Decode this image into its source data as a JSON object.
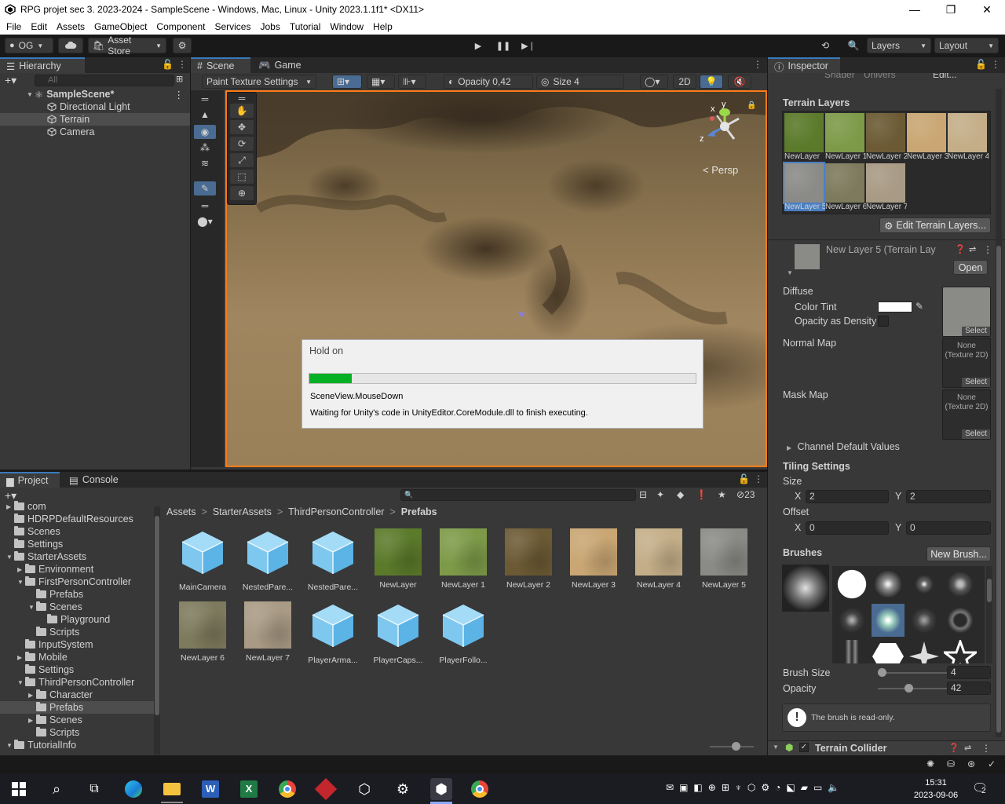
{
  "window": {
    "title": "RPG projet sec 3. 2023-2024 - SampleScene - Windows, Mac, Linux - Unity 2023.1.1f1* <DX11>",
    "controls": [
      "—",
      "❐",
      "✕"
    ]
  },
  "menu": [
    "File",
    "Edit",
    "Assets",
    "GameObject",
    "Component",
    "Services",
    "Jobs",
    "Tutorial",
    "Window",
    "Help"
  ],
  "toolbar": {
    "account": "OG",
    "asset_store": "Asset Store",
    "layers": "Layers",
    "layout": "Layout"
  },
  "hierarchy": {
    "tab": "Hierarchy",
    "search_placeholder": "All",
    "scene": "SampleScene*",
    "items": [
      "Directional Light",
      "Terrain",
      "Camera"
    ]
  },
  "scene": {
    "tabs": [
      "Scene",
      "Game"
    ],
    "tool_dropdown": "Paint Texture Settings",
    "opacity_label": "Opacity 0,42",
    "size_label": "Size 4",
    "mode_2d": "2D",
    "persp": "Persp",
    "gizmo": {
      "y": "y",
      "x": "x",
      "z": "z"
    }
  },
  "dialog": {
    "title": "Hold on",
    "progress": 0.11,
    "line1": "SceneView.MouseDown",
    "line2": "Waiting for Unity's code in UnityEditor.CoreModule.dll to finish executing."
  },
  "inspector": {
    "tab": "Inspector",
    "top_row": {
      "shader": "Shader",
      "univers": "Univers",
      "edit": "Edit..."
    },
    "terrain_layers_title": "Terrain Layers",
    "layers": [
      {
        "caption": "NewLayer",
        "color": "#5b7a2a"
      },
      {
        "caption": "NewLayer 1",
        "color": "#7d9a48"
      },
      {
        "caption": "NewLayer 2",
        "color": "#6b5a34"
      },
      {
        "caption": "NewLayer 3",
        "color": "#c9a673"
      },
      {
        "caption": "NewLayer 4",
        "color": "#c4ae88"
      },
      {
        "caption": "NewLayer 5",
        "color": "#8a8a86"
      },
      {
        "caption": "NewLayer 6",
        "color": "#7d7a5d"
      },
      {
        "caption": "NewLayer 7",
        "color": "#a89a84"
      }
    ],
    "edit_layers_button": "Edit Terrain Layers...",
    "layer_name": "New Layer 5 (Terrain Lay",
    "open_button": "Open",
    "diffuse": "Diffuse",
    "color_tint": "Color Tint",
    "opacity_density": "Opacity as Density",
    "normal_map": "Normal Map",
    "mask_map": "Mask Map",
    "none_texture": "None\n(Texture 2D)",
    "select": "Select",
    "channel_defaults": "Channel Default Values",
    "tiling_title": "Tiling Settings",
    "size_label": "Size",
    "offset_label": "Offset",
    "x_label": "X",
    "y_label": "Y",
    "size_x": "2",
    "size_y": "2",
    "offset_x": "0",
    "offset_y": "0",
    "brushes_title": "Brushes",
    "new_brush": "New Brush...",
    "brush_size_label": "Brush Size",
    "brush_size_value": "4",
    "brush_size_fraction": 0.05,
    "opacity_label": "Opacity",
    "opacity_value": "42",
    "opacity_fraction": 0.42,
    "readonly_msg": "The brush is read-only.",
    "collider": "Terrain Collider"
  },
  "project": {
    "tabs": [
      "Project",
      "Console"
    ],
    "count": "23",
    "breadcrumb": [
      "Assets",
      "StarterAssets",
      "ThirdPersonController",
      "Prefabs"
    ],
    "tree": [
      {
        "label": "com",
        "indent": 1,
        "arrow": "▶"
      },
      {
        "label": "HDRPDefaultResources",
        "indent": 1,
        "arrow": ""
      },
      {
        "label": "Scenes",
        "indent": 1,
        "arrow": ""
      },
      {
        "label": "Settings",
        "indent": 1,
        "arrow": ""
      },
      {
        "label": "StarterAssets",
        "indent": 1,
        "arrow": "▼"
      },
      {
        "label": "Environment",
        "indent": 2,
        "arrow": "▶"
      },
      {
        "label": "FirstPersonController",
        "indent": 2,
        "arrow": "▼"
      },
      {
        "label": "Prefabs",
        "indent": 3,
        "arrow": ""
      },
      {
        "label": "Scenes",
        "indent": 3,
        "arrow": "▼"
      },
      {
        "label": "Playground",
        "indent": 4,
        "arrow": ""
      },
      {
        "label": "Scripts",
        "indent": 3,
        "arrow": ""
      },
      {
        "label": "InputSystem",
        "indent": 2,
        "arrow": ""
      },
      {
        "label": "Mobile",
        "indent": 2,
        "arrow": "▶"
      },
      {
        "label": "Settings",
        "indent": 2,
        "arrow": ""
      },
      {
        "label": "ThirdPersonController",
        "indent": 2,
        "arrow": "▼"
      },
      {
        "label": "Character",
        "indent": 3,
        "arrow": "▶"
      },
      {
        "label": "Prefabs",
        "indent": 3,
        "arrow": ""
      },
      {
        "label": "Scenes",
        "indent": 3,
        "arrow": "▶"
      },
      {
        "label": "Scripts",
        "indent": 3,
        "arrow": ""
      },
      {
        "label": "TutorialInfo",
        "indent": 1,
        "arrow": "▼"
      }
    ],
    "assets": [
      {
        "caption": "MainCamera",
        "kind": "prefab",
        "color": ""
      },
      {
        "caption": "NestedPare...",
        "kind": "prefab",
        "color": ""
      },
      {
        "caption": "NestedPare...",
        "kind": "prefab",
        "color": ""
      },
      {
        "caption": "NewLayer",
        "kind": "tex",
        "color": "#5b7a2a"
      },
      {
        "caption": "NewLayer 1",
        "kind": "tex",
        "color": "#7d9a48"
      },
      {
        "caption": "NewLayer 2",
        "kind": "tex",
        "color": "#6b5a34"
      },
      {
        "caption": "NewLayer 3",
        "kind": "tex",
        "color": "#c9a673"
      },
      {
        "caption": "NewLayer 4",
        "kind": "tex",
        "color": "#c4ae88"
      },
      {
        "caption": "NewLayer 5",
        "kind": "tex",
        "color": "#8a8a86"
      },
      {
        "caption": "NewLayer 6",
        "kind": "tex",
        "color": "#7d7a5d"
      },
      {
        "caption": "NewLayer 7",
        "kind": "tex",
        "color": "#a89a84"
      },
      {
        "caption": "PlayerArma...",
        "kind": "prefab",
        "color": ""
      },
      {
        "caption": "PlayerCaps...",
        "kind": "prefab",
        "color": ""
      },
      {
        "caption": "PlayerFollo...",
        "kind": "prefab",
        "color": ""
      }
    ]
  },
  "taskbar": {
    "time": "15:31",
    "date": "2023-09-06",
    "notifications": "2"
  }
}
